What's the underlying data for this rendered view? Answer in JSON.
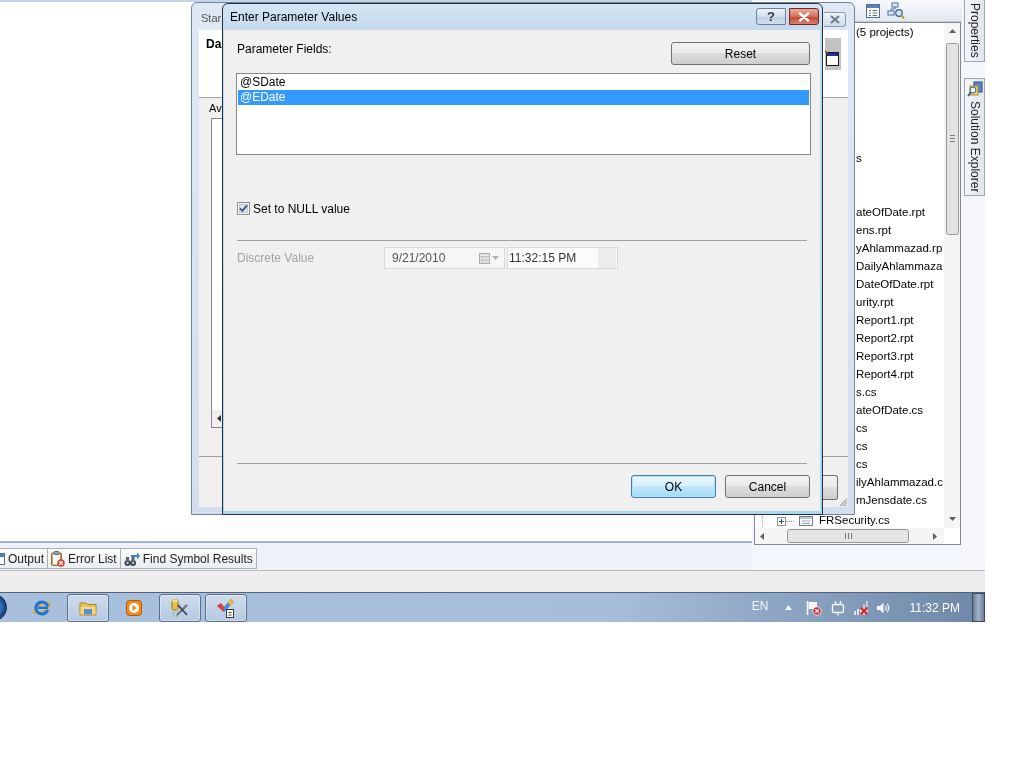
{
  "background_dialog": {
    "title": "Star",
    "header_title": "Da",
    "group_label": "Av"
  },
  "dialog": {
    "title": "Enter Parameter Values",
    "help_button": "?",
    "parameter_fields_label": "Parameter Fields:",
    "reset_button": "Reset",
    "parameters": [
      {
        "name": "@SDate",
        "selected": false
      },
      {
        "name": "@EDate",
        "selected": true
      }
    ],
    "null_checkbox": {
      "label": "Set to NULL value",
      "checked": true
    },
    "discrete_value": {
      "label": "Discrete Value",
      "date": "9/21/2010",
      "time": "11:32:15 PM",
      "disabled": true
    },
    "buttons": [
      {
        "label": "OK",
        "default": true
      },
      {
        "label": "Cancel",
        "default": false
      }
    ]
  },
  "solution_explorer": {
    "tree_rows": [
      {
        "label": "(5 projects)"
      },
      {
        "label": "s"
      },
      {
        "label": "ateOfDate.rpt"
      },
      {
        "label": "ens.rpt"
      },
      {
        "label": "yAhlammazad.rp"
      },
      {
        "label": "DailyAhlammaza"
      },
      {
        "label": "DateOfDate.rpt"
      },
      {
        "label": "urity.rpt"
      },
      {
        "label": "Report1.rpt"
      },
      {
        "label": "Report2.rpt"
      },
      {
        "label": "Report3.rpt"
      },
      {
        "label": "Report4.rpt"
      },
      {
        "label": "s.cs"
      },
      {
        "label": "ateOfDate.cs"
      },
      {
        "label": "cs"
      },
      {
        "label": "cs"
      },
      {
        "label": "cs"
      },
      {
        "label": "ilyAhlammazad.c"
      },
      {
        "label": "mJensdate.cs"
      }
    ],
    "last_row": {
      "label": "FRSecurity.cs",
      "expanded": false
    }
  },
  "side_tabs": [
    {
      "label": "Properties",
      "kind": "properties"
    },
    {
      "label": "Solution Explorer",
      "kind": "solution_explorer"
    }
  ],
  "bottom_tabs": [
    {
      "label": "Output",
      "kind": "output"
    },
    {
      "label": "Error List",
      "kind": "error_list"
    },
    {
      "label": "Find Symbol Results",
      "kind": "find_symbol"
    }
  ],
  "taskbar": {
    "apps": [
      {
        "kind": "browser",
        "running": false
      },
      {
        "kind": "folder",
        "running": true
      },
      {
        "kind": "media_player",
        "running": false
      },
      {
        "kind": "tools",
        "running": true
      },
      {
        "kind": "app",
        "running": true
      }
    ],
    "language": "EN",
    "clock": "11:32 PM"
  }
}
